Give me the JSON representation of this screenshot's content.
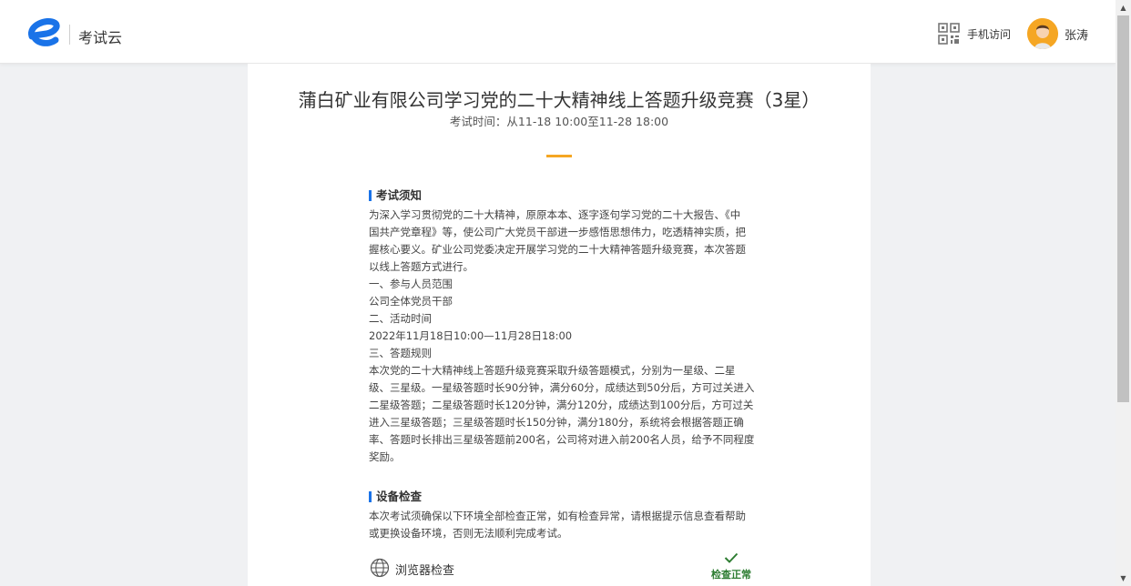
{
  "header": {
    "app_title": "考试云",
    "mobile_access_label": "手机访问",
    "user_name": "张涛"
  },
  "exam": {
    "title": "蒲白矿业有限公司学习党的二十大精神线上答题升级竞赛（3星）",
    "time": "考试时间：从11-18 10:00至11-28 18:00"
  },
  "notice": {
    "heading": "考试须知",
    "lines": [
      "为深入学习贯彻党的二十大精神，原原本本、逐字逐句学习党的二十大报告、《中",
      "国共产党章程》等，使公司广大党员干部进一步感悟思想伟力，吃透精神实质，把",
      "握核心要义。矿业公司党委决定开展学习党的二十大精神答题升级竞赛，本次答题",
      "以线上答题方式进行。",
      "一、参与人员范围",
      "公司全体党员干部",
      "二、活动时间",
      "2022年11月18日10:00—11月28日18:00",
      "三、答题规则",
      "本次党的二十大精神线上答题升级竞赛采取升级答题模式，分别为一星级、二星",
      "级、三星级。一星级答题时长90分钟，满分60分，成绩达到50分后，方可过关进入",
      "二星级答题；二星级答题时长120分钟，满分120分，成绩达到100分后，方可过关",
      "进入三星级答题；三星级答题时长150分钟，满分180分，系统将会根据答题正确",
      "率、答题时长排出三星级答题前200名，公司将对进入前200名人员，给予不同程度",
      "奖励。"
    ]
  },
  "device_check": {
    "heading": "设备检查",
    "lines": [
      "本次考试须确保以下环境全部检查正常，如有检查异常，请根据提示信息查看帮助",
      "或更换设备环境，否则无法顺利完成考试。"
    ],
    "browser_check_label": "浏览器检查",
    "browser_check_status": "检查正常"
  },
  "colors": {
    "accent_blue": "#1a73e8",
    "accent_orange": "#f5a623",
    "success_green": "#2e7d32"
  }
}
